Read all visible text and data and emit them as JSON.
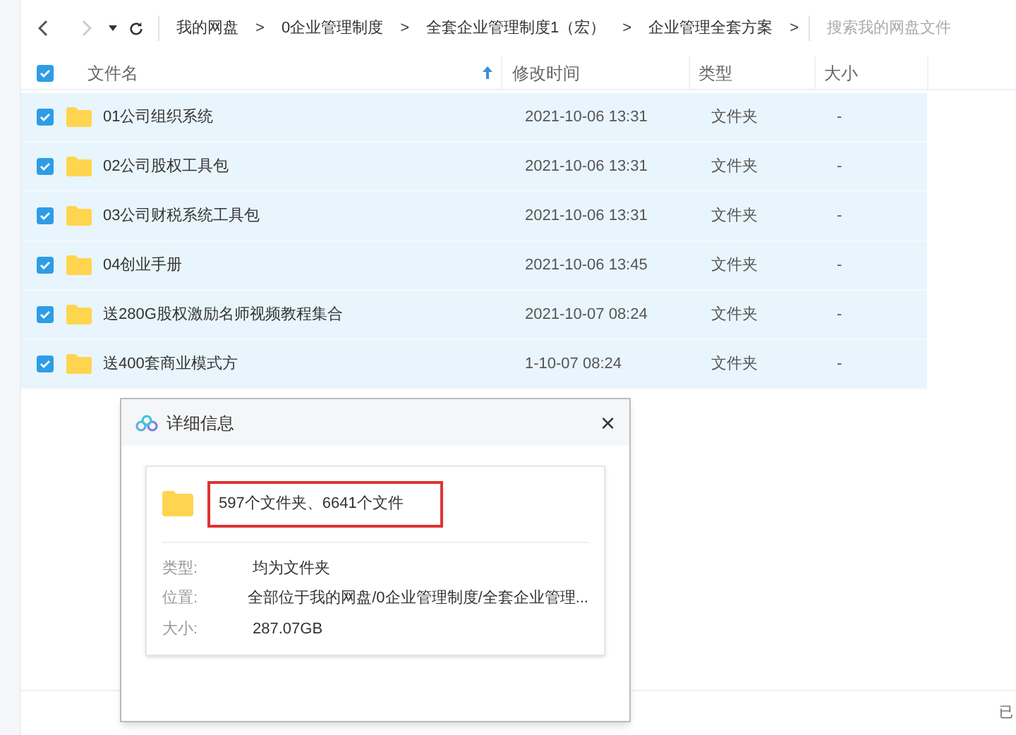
{
  "toolbar": {
    "breadcrumbs": [
      "我的网盘",
      "0企业管理制度",
      "全套企业管理制度1（宏）",
      "企业管理全套方案"
    ],
    "separator": ">",
    "search": {
      "placeholder": "搜索我的网盘文件"
    }
  },
  "table": {
    "all_checked": true,
    "columns": [
      "文件名",
      "修改时间",
      "类型",
      "大小"
    ],
    "rows": [
      {
        "name": "01公司组织系统",
        "modified": "2021-10-06 13:31",
        "type": "文件夹",
        "size": "-",
        "checked": true
      },
      {
        "name": "02公司股权工具包",
        "modified": "2021-10-06 13:31",
        "type": "文件夹",
        "size": "-",
        "checked": true
      },
      {
        "name": "03公司财税系统工具包",
        "modified": "2021-10-06 13:31",
        "type": "文件夹",
        "size": "-",
        "checked": true
      },
      {
        "name": "04创业手册",
        "modified": "2021-10-06 13:45",
        "type": "文件夹",
        "size": "-",
        "checked": true
      },
      {
        "name": "送280G股权激励名师视频教程集合",
        "modified": "2021-10-07 08:24",
        "type": "文件夹",
        "size": "-",
        "checked": true
      },
      {
        "name": "送400套商业模式方",
        "modified": "1-10-07 08:24",
        "type": "文件夹",
        "size": "-",
        "checked": true
      }
    ]
  },
  "dialog": {
    "title": "详细信息",
    "close": "×",
    "summary": "597个文件夹、6641个文件",
    "details": [
      {
        "label": "类型:",
        "value": "均为文件夹"
      },
      {
        "label": "位置:",
        "value": "全部位于我的网盘/0企业管理制度/全套企业管理..."
      },
      {
        "label": "大小:",
        "value": "287.07GB"
      }
    ]
  },
  "status_bar": {
    "text": "已"
  }
}
